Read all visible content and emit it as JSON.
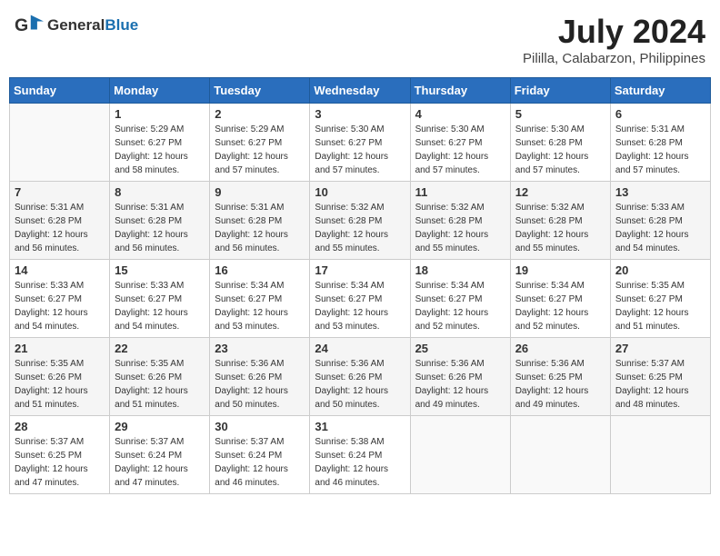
{
  "logo": {
    "general": "General",
    "blue": "Blue"
  },
  "header": {
    "title": "July 2024",
    "subtitle": "Pililla, Calabarzon, Philippines"
  },
  "days_of_week": [
    "Sunday",
    "Monday",
    "Tuesday",
    "Wednesday",
    "Thursday",
    "Friday",
    "Saturday"
  ],
  "weeks": [
    [
      {
        "day": "",
        "info": ""
      },
      {
        "day": "1",
        "info": "Sunrise: 5:29 AM\nSunset: 6:27 PM\nDaylight: 12 hours\nand 58 minutes."
      },
      {
        "day": "2",
        "info": "Sunrise: 5:29 AM\nSunset: 6:27 PM\nDaylight: 12 hours\nand 57 minutes."
      },
      {
        "day": "3",
        "info": "Sunrise: 5:30 AM\nSunset: 6:27 PM\nDaylight: 12 hours\nand 57 minutes."
      },
      {
        "day": "4",
        "info": "Sunrise: 5:30 AM\nSunset: 6:27 PM\nDaylight: 12 hours\nand 57 minutes."
      },
      {
        "day": "5",
        "info": "Sunrise: 5:30 AM\nSunset: 6:28 PM\nDaylight: 12 hours\nand 57 minutes."
      },
      {
        "day": "6",
        "info": "Sunrise: 5:31 AM\nSunset: 6:28 PM\nDaylight: 12 hours\nand 57 minutes."
      }
    ],
    [
      {
        "day": "7",
        "info": "Sunrise: 5:31 AM\nSunset: 6:28 PM\nDaylight: 12 hours\nand 56 minutes."
      },
      {
        "day": "8",
        "info": "Sunrise: 5:31 AM\nSunset: 6:28 PM\nDaylight: 12 hours\nand 56 minutes."
      },
      {
        "day": "9",
        "info": "Sunrise: 5:31 AM\nSunset: 6:28 PM\nDaylight: 12 hours\nand 56 minutes."
      },
      {
        "day": "10",
        "info": "Sunrise: 5:32 AM\nSunset: 6:28 PM\nDaylight: 12 hours\nand 55 minutes."
      },
      {
        "day": "11",
        "info": "Sunrise: 5:32 AM\nSunset: 6:28 PM\nDaylight: 12 hours\nand 55 minutes."
      },
      {
        "day": "12",
        "info": "Sunrise: 5:32 AM\nSunset: 6:28 PM\nDaylight: 12 hours\nand 55 minutes."
      },
      {
        "day": "13",
        "info": "Sunrise: 5:33 AM\nSunset: 6:28 PM\nDaylight: 12 hours\nand 54 minutes."
      }
    ],
    [
      {
        "day": "14",
        "info": "Sunrise: 5:33 AM\nSunset: 6:27 PM\nDaylight: 12 hours\nand 54 minutes."
      },
      {
        "day": "15",
        "info": "Sunrise: 5:33 AM\nSunset: 6:27 PM\nDaylight: 12 hours\nand 54 minutes."
      },
      {
        "day": "16",
        "info": "Sunrise: 5:34 AM\nSunset: 6:27 PM\nDaylight: 12 hours\nand 53 minutes."
      },
      {
        "day": "17",
        "info": "Sunrise: 5:34 AM\nSunset: 6:27 PM\nDaylight: 12 hours\nand 53 minutes."
      },
      {
        "day": "18",
        "info": "Sunrise: 5:34 AM\nSunset: 6:27 PM\nDaylight: 12 hours\nand 52 minutes."
      },
      {
        "day": "19",
        "info": "Sunrise: 5:34 AM\nSunset: 6:27 PM\nDaylight: 12 hours\nand 52 minutes."
      },
      {
        "day": "20",
        "info": "Sunrise: 5:35 AM\nSunset: 6:27 PM\nDaylight: 12 hours\nand 51 minutes."
      }
    ],
    [
      {
        "day": "21",
        "info": "Sunrise: 5:35 AM\nSunset: 6:26 PM\nDaylight: 12 hours\nand 51 minutes."
      },
      {
        "day": "22",
        "info": "Sunrise: 5:35 AM\nSunset: 6:26 PM\nDaylight: 12 hours\nand 51 minutes."
      },
      {
        "day": "23",
        "info": "Sunrise: 5:36 AM\nSunset: 6:26 PM\nDaylight: 12 hours\nand 50 minutes."
      },
      {
        "day": "24",
        "info": "Sunrise: 5:36 AM\nSunset: 6:26 PM\nDaylight: 12 hours\nand 50 minutes."
      },
      {
        "day": "25",
        "info": "Sunrise: 5:36 AM\nSunset: 6:26 PM\nDaylight: 12 hours\nand 49 minutes."
      },
      {
        "day": "26",
        "info": "Sunrise: 5:36 AM\nSunset: 6:25 PM\nDaylight: 12 hours\nand 49 minutes."
      },
      {
        "day": "27",
        "info": "Sunrise: 5:37 AM\nSunset: 6:25 PM\nDaylight: 12 hours\nand 48 minutes."
      }
    ],
    [
      {
        "day": "28",
        "info": "Sunrise: 5:37 AM\nSunset: 6:25 PM\nDaylight: 12 hours\nand 47 minutes."
      },
      {
        "day": "29",
        "info": "Sunrise: 5:37 AM\nSunset: 6:24 PM\nDaylight: 12 hours\nand 47 minutes."
      },
      {
        "day": "30",
        "info": "Sunrise: 5:37 AM\nSunset: 6:24 PM\nDaylight: 12 hours\nand 46 minutes."
      },
      {
        "day": "31",
        "info": "Sunrise: 5:38 AM\nSunset: 6:24 PM\nDaylight: 12 hours\nand 46 minutes."
      },
      {
        "day": "",
        "info": ""
      },
      {
        "day": "",
        "info": ""
      },
      {
        "day": "",
        "info": ""
      }
    ]
  ]
}
